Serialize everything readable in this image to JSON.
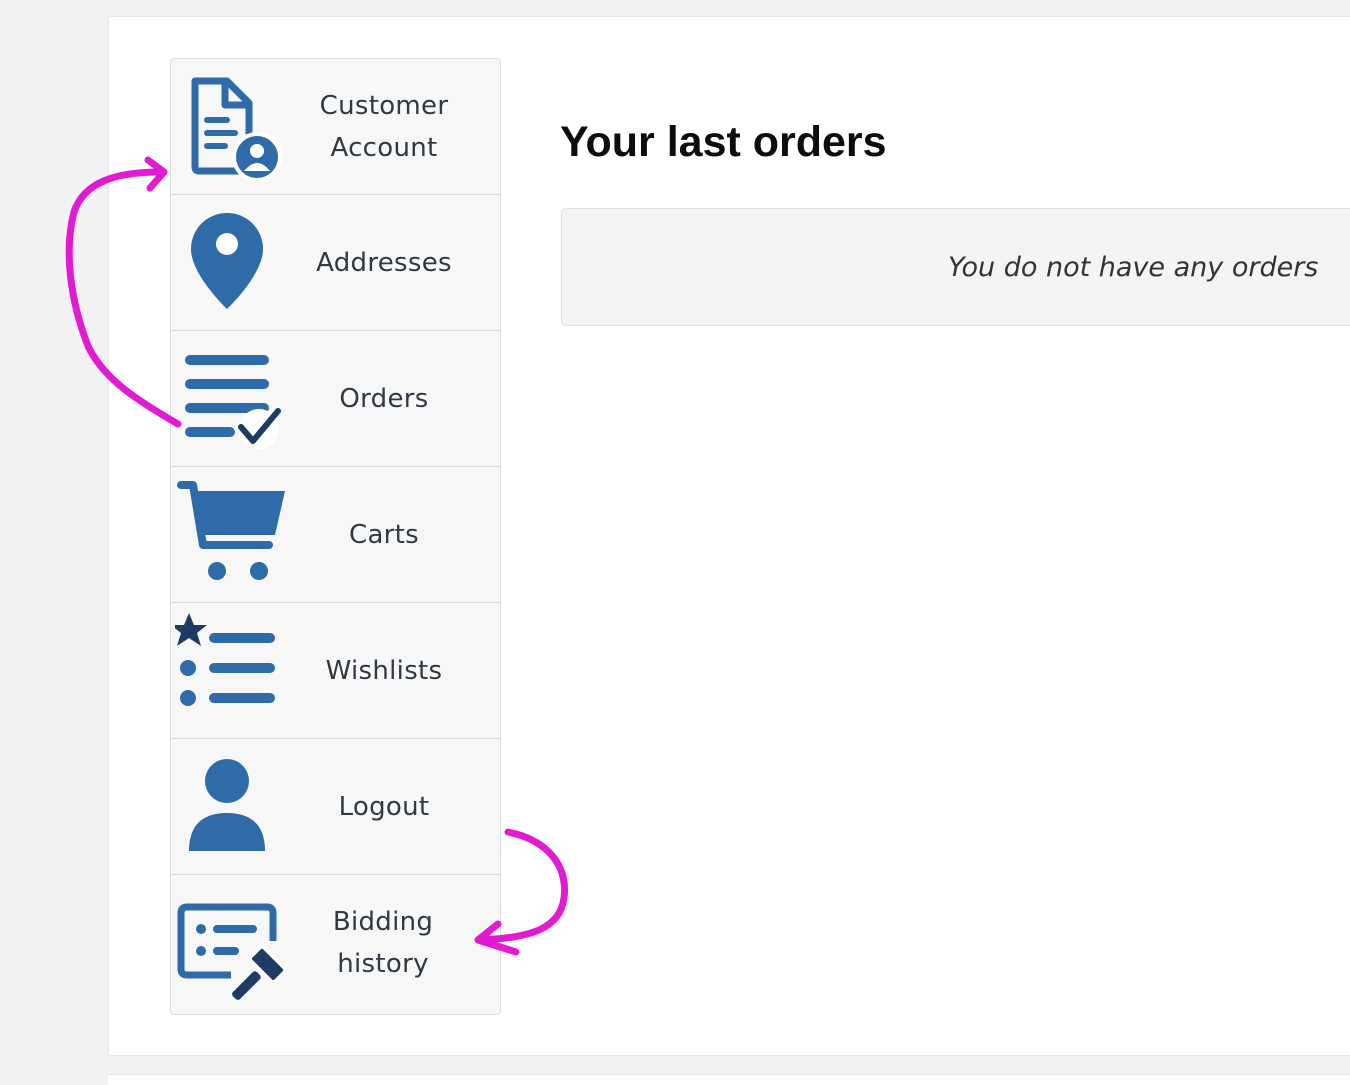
{
  "sidebar": {
    "items": [
      {
        "label": "Customer Account",
        "icon": "customer-account-icon"
      },
      {
        "label": "Addresses",
        "icon": "location-pin-icon"
      },
      {
        "label": "Orders",
        "icon": "orders-list-check-icon"
      },
      {
        "label": "Carts",
        "icon": "cart-icon"
      },
      {
        "label": "Wishlists",
        "icon": "wishlist-star-icon"
      },
      {
        "label": "Logout",
        "icon": "user-icon"
      },
      {
        "label": "Bidding history",
        "icon": "bidding-gavel-icon"
      }
    ]
  },
  "main": {
    "title": "Your last orders",
    "empty_message": "You do not have any orders"
  },
  "colors": {
    "icon_blue": "#2f6aa9",
    "icon_navy": "#1d3b63",
    "annotation_magenta": "#e21ad3"
  }
}
